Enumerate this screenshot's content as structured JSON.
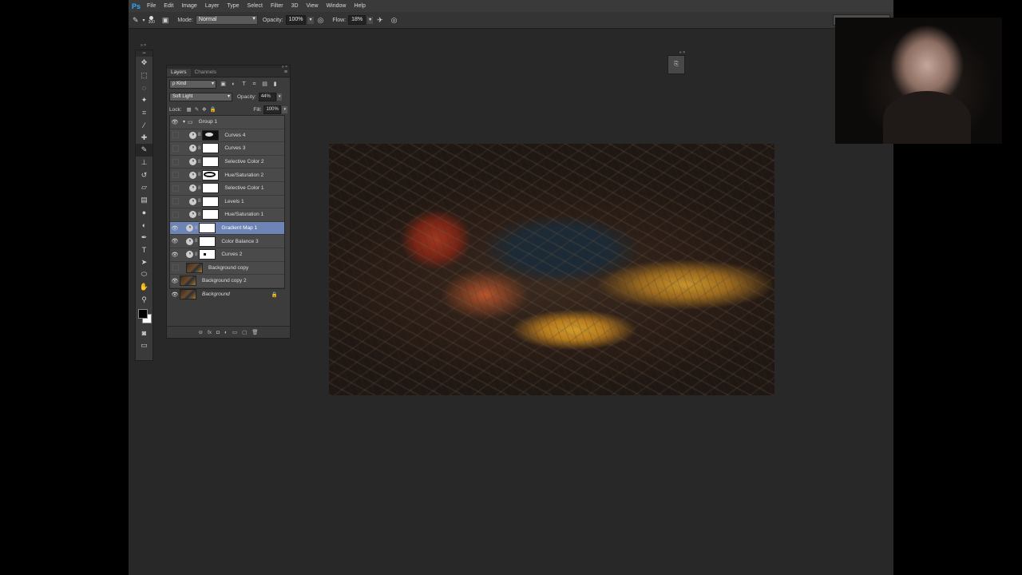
{
  "app": {
    "logo": "Ps"
  },
  "menu": [
    "File",
    "Edit",
    "Image",
    "Layer",
    "Type",
    "Select",
    "Filter",
    "3D",
    "View",
    "Window",
    "Help"
  ],
  "options": {
    "brush_size": "300",
    "mode_label": "Mode:",
    "mode_value": "Normal",
    "opacity_label": "Opacity:",
    "opacity_value": "100%",
    "flow_label": "Flow:",
    "flow_value": "18%"
  },
  "layers_panel": {
    "tabs": [
      "Layers",
      "Channels"
    ],
    "kind_filter": "ρ Kind",
    "blend_mode": "Soft Light",
    "opacity_label": "Opacity:",
    "opacity_value": "44%",
    "lock_label": "Lock:",
    "fill_label": "Fill:",
    "fill_value": "100%",
    "layers": [
      {
        "name": "Group 1",
        "visible": true
      },
      {
        "name": "Curves 4",
        "visible": false
      },
      {
        "name": "Curves 3",
        "visible": false
      },
      {
        "name": "Selective Color 2",
        "visible": false
      },
      {
        "name": "Hue/Saturation 2",
        "visible": false
      },
      {
        "name": "Selective Color 1",
        "visible": false
      },
      {
        "name": "Levels 1",
        "visible": false
      },
      {
        "name": "Hue/Saturation 1",
        "visible": false
      },
      {
        "name": "Gradient Map 1",
        "visible": true,
        "selected": true
      },
      {
        "name": "Color Balance 3",
        "visible": true
      },
      {
        "name": "Curves 2",
        "visible": true
      },
      {
        "name": "Background copy",
        "visible": false
      },
      {
        "name": "Background copy 2",
        "visible": true
      },
      {
        "name": "Background",
        "visible": true,
        "locked": true
      }
    ]
  },
  "colors": {
    "selected_layer": "#6d84b4",
    "workspace": "#282828"
  }
}
